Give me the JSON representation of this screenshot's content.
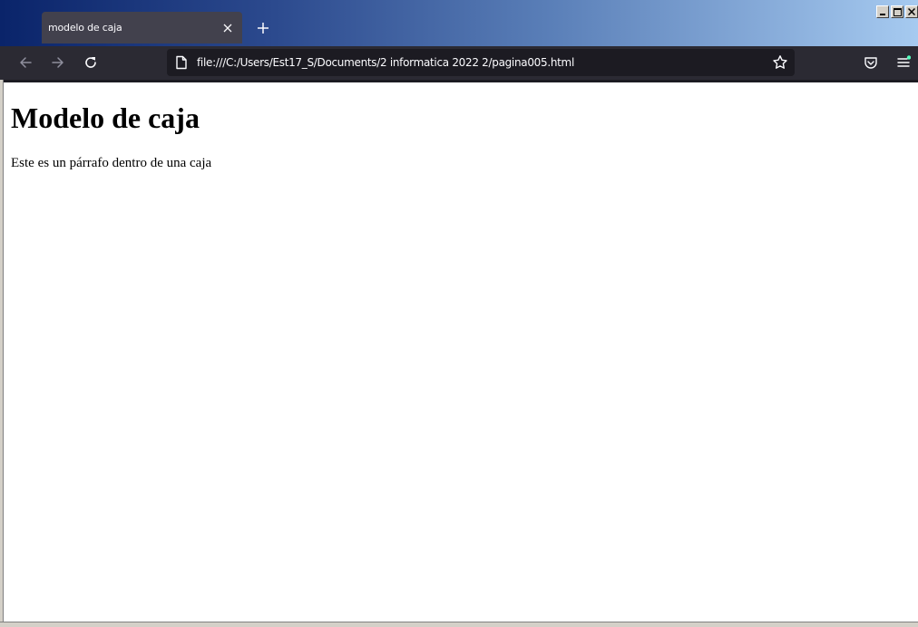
{
  "browser": {
    "tab": {
      "title": "modelo de caja",
      "close_icon": "close-icon"
    },
    "new_tab_icon": "plus-icon",
    "window_controls": [
      "minimize",
      "maximize",
      "close"
    ],
    "nav": {
      "back_icon": "back-arrow-icon",
      "forward_icon": "forward-arrow-icon",
      "reload_icon": "reload-icon"
    },
    "url": "file:///C:/Users/Est17_S/Documents/2 informatica 2022 2/pagina005.html",
    "page_icon": "document-icon",
    "bookmark_icon": "star-icon",
    "pocket_icon": "pocket-icon",
    "menu_icon": "hamburger-menu-icon",
    "colors": {
      "tab_bg": "#42414d",
      "toolbar_bg": "#2b2a33",
      "urlbar_bg": "#1c1b22",
      "text_light": "#fbfbfe",
      "notification_dot": "#54ffbd"
    }
  },
  "page": {
    "heading": "Modelo de caja",
    "paragraph": "Este es un párrafo dentro de una caja"
  }
}
